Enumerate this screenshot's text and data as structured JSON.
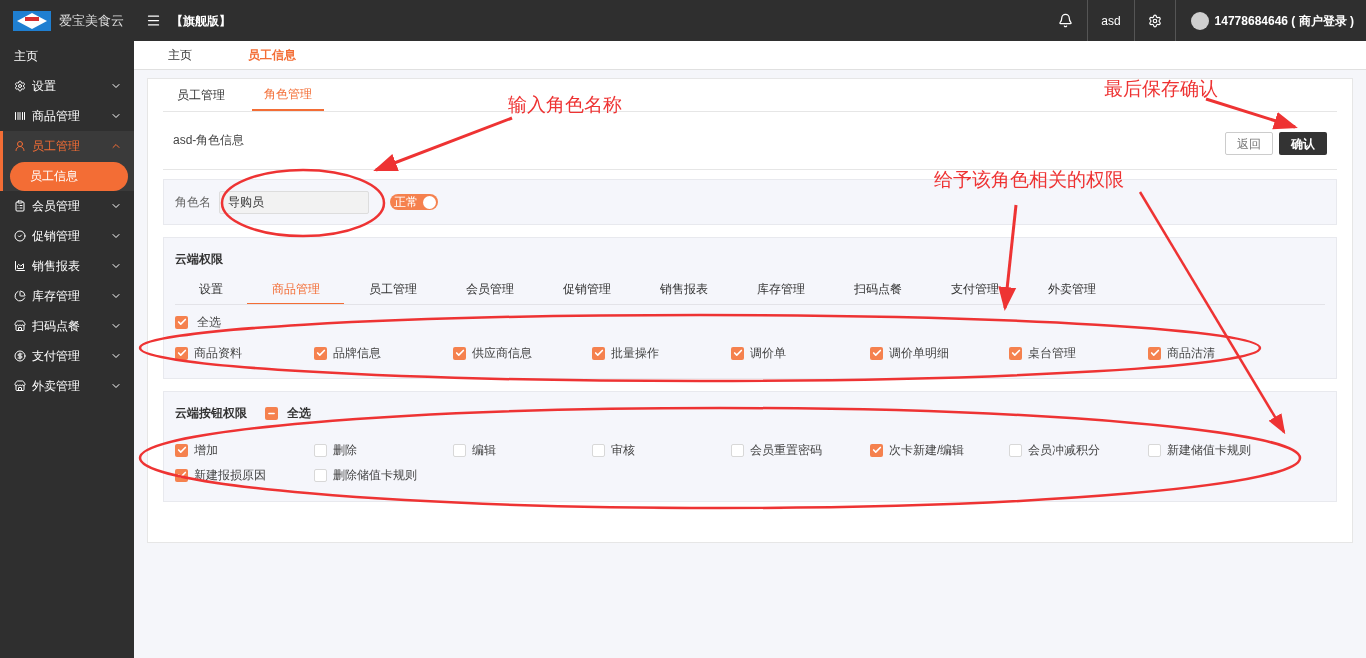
{
  "topbar": {
    "brand": "爱宝美食云",
    "edition": "【旗舰版】",
    "user": "asd",
    "account": "14778684646 ( 商户登录 )"
  },
  "sidebar": {
    "items": [
      {
        "label": "主页",
        "selected": false
      },
      {
        "label": "设置",
        "expanded": false,
        "selected": false
      },
      {
        "label": "商品管理",
        "expanded": false,
        "selected": false
      },
      {
        "label": "员工管理",
        "expanded": true,
        "selected": true,
        "children": [
          {
            "label": "员工信息",
            "selected": true
          }
        ]
      },
      {
        "label": "会员管理",
        "expanded": false,
        "selected": false
      },
      {
        "label": "促销管理",
        "expanded": false,
        "selected": false
      },
      {
        "label": "销售报表",
        "expanded": false,
        "selected": false
      },
      {
        "label": "库存管理",
        "expanded": false,
        "selected": false
      },
      {
        "label": "扫码点餐",
        "expanded": false,
        "selected": false
      },
      {
        "label": "支付管理",
        "expanded": false,
        "selected": false
      },
      {
        "label": "外卖管理",
        "expanded": false,
        "selected": false
      }
    ]
  },
  "page_tabs": [
    {
      "label": "主页",
      "selected": false
    },
    {
      "label": "员工信息",
      "selected": true
    }
  ],
  "tabs": [
    {
      "label": "员工管理",
      "selected": false
    },
    {
      "label": "角色管理",
      "selected": true
    }
  ],
  "header": {
    "title": "asd-角色信息",
    "buttons": [
      {
        "label": "返回",
        "kind": "secondary"
      },
      {
        "label": "确认",
        "kind": "primary"
      }
    ]
  },
  "role": {
    "label": "角色名",
    "value": "导购员",
    "status": {
      "label": "正常",
      "on": true
    }
  },
  "cloud_permissions": {
    "title": "云端权限",
    "tabs": [
      {
        "label": "设置",
        "selected": false
      },
      {
        "label": "商品管理",
        "selected": true
      },
      {
        "label": "员工管理",
        "selected": false
      },
      {
        "label": "会员管理",
        "selected": false
      },
      {
        "label": "促销管理",
        "selected": false
      },
      {
        "label": "销售报表",
        "selected": false
      },
      {
        "label": "库存管理",
        "selected": false
      },
      {
        "label": "扫码点餐",
        "selected": false
      },
      {
        "label": "支付管理",
        "selected": false
      },
      {
        "label": "外卖管理",
        "selected": false
      }
    ],
    "select_all": {
      "label": "全选",
      "checked": true
    },
    "items": [
      {
        "label": "商品资料",
        "checked": true
      },
      {
        "label": "品牌信息",
        "checked": true
      },
      {
        "label": "供应商信息",
        "checked": true
      },
      {
        "label": "批量操作",
        "checked": true
      },
      {
        "label": "调价单",
        "checked": true
      },
      {
        "label": "调价单明细",
        "checked": true
      },
      {
        "label": "桌台管理",
        "checked": true
      },
      {
        "label": "商品沽清",
        "checked": true
      }
    ]
  },
  "button_permissions": {
    "title": "云端按钮权限",
    "select_all": {
      "label": "全选",
      "indeterminate": true
    },
    "items": [
      {
        "label": "增加",
        "checked": true
      },
      {
        "label": "删除",
        "checked": false
      },
      {
        "label": "编辑",
        "checked": false
      },
      {
        "label": "审核",
        "checked": false
      },
      {
        "label": "会员重置密码",
        "checked": false
      },
      {
        "label": "次卡新建/编辑",
        "checked": true
      },
      {
        "label": "会员冲减积分",
        "checked": false
      },
      {
        "label": "新建储值卡规则",
        "checked": false
      },
      {
        "label": "新建报损原因",
        "checked": true
      },
      {
        "label": "删除储值卡规则",
        "checked": false
      }
    ]
  },
  "annotations": [
    "输入角色名称",
    "最后保存确认",
    "给予该角色相关的权限"
  ]
}
